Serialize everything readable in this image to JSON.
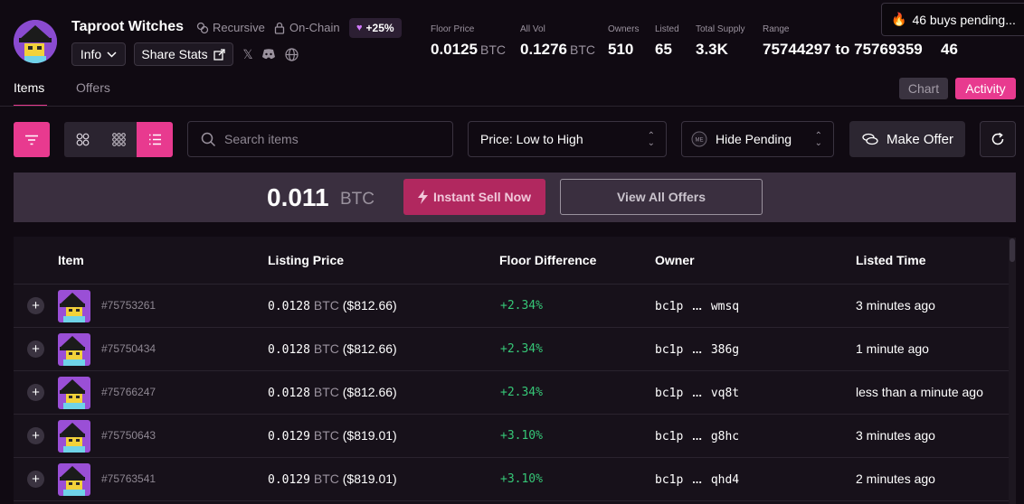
{
  "collection": {
    "name": "Taproot Witches",
    "tags": {
      "recursive": "Recursive",
      "onchain": "On-Chain"
    },
    "change": "+25%",
    "info_label": "Info",
    "share_label": "Share Stats"
  },
  "stats": {
    "floor": {
      "label": "Floor Price",
      "value": "0.0125",
      "unit": "BTC"
    },
    "vol": {
      "label": "All Vol",
      "value": "0.1276",
      "unit": "BTC"
    },
    "owners": {
      "label": "Owners",
      "value": "510"
    },
    "listed": {
      "label": "Listed",
      "value": "65"
    },
    "supply": {
      "label": "Total Supply",
      "value": "3.3K"
    },
    "range": {
      "label": "Range",
      "value": "75744297 to 75769359"
    },
    "extra": "46"
  },
  "pending_banner": "46 buys pending...",
  "tabs": {
    "items": "Items",
    "offers": "Offers",
    "chart": "Chart",
    "activity": "Activity"
  },
  "toolbar": {
    "search_placeholder": "Search items",
    "sort_value": "Price: Low to High",
    "pending_filter": "Hide Pending",
    "make_offer": "Make Offer"
  },
  "sellbar": {
    "price": "0.011",
    "unit": "BTC",
    "instant_sell": "Instant Sell Now",
    "view_offers": "View All Offers"
  },
  "table": {
    "headers": {
      "item": "Item",
      "price": "Listing Price",
      "diff": "Floor Difference",
      "owner": "Owner",
      "time": "Listed Time"
    },
    "rows": [
      {
        "inscription": "#75753261",
        "btc": "0.0128",
        "unit": "BTC",
        "usd": "($812.66)",
        "diff": "+2.34%",
        "owner_start": "bc1p",
        "owner_sep": "...",
        "owner_end": "wmsq",
        "time": "3 minutes ago"
      },
      {
        "inscription": "#75750434",
        "btc": "0.0128",
        "unit": "BTC",
        "usd": "($812.66)",
        "diff": "+2.34%",
        "owner_start": "bc1p",
        "owner_sep": "...",
        "owner_end": "386g",
        "time": "1 minute ago"
      },
      {
        "inscription": "#75766247",
        "btc": "0.0128",
        "unit": "BTC",
        "usd": "($812.66)",
        "diff": "+2.34%",
        "owner_start": "bc1p",
        "owner_sep": "...",
        "owner_end": "vq8t",
        "time": "less than a minute ago"
      },
      {
        "inscription": "#75750643",
        "btc": "0.0129",
        "unit": "BTC",
        "usd": "($819.01)",
        "diff": "+3.10%",
        "owner_start": "bc1p",
        "owner_sep": "...",
        "owner_end": "g8hc",
        "time": "3 minutes ago"
      },
      {
        "inscription": "#75763541",
        "btc": "0.0129",
        "unit": "BTC",
        "usd": "($819.01)",
        "diff": "+3.10%",
        "owner_start": "bc1p",
        "owner_sep": "...",
        "owner_end": "qhd4",
        "time": "2 minutes ago"
      }
    ]
  },
  "colors": {
    "accent": "#e83a8f",
    "positive": "#36c777",
    "background": "#100a12"
  }
}
